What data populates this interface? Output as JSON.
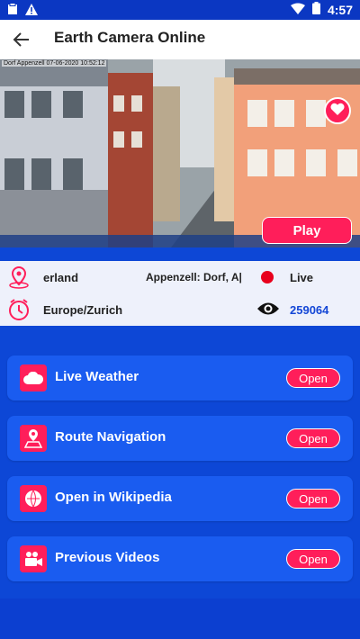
{
  "status": {
    "time": "4:57",
    "left_icons": [
      "clipboard-icon",
      "alert-icon"
    ],
    "right_icons": [
      "wifi-icon",
      "battery-icon"
    ]
  },
  "appbar": {
    "title": "Earth Camera Online"
  },
  "camera": {
    "timestamp": "Dorf Appenzell 07-06-2020 10:52:12",
    "play_label": "Play"
  },
  "info": {
    "location_country": "erland",
    "location_name": "Appenzell: Dorf, A|",
    "live_label": "Live",
    "timezone": "Europe/Zurich",
    "views": "259064"
  },
  "cards": [
    {
      "label": "Live Weather",
      "button": "Open",
      "icon": "cloud-icon"
    },
    {
      "label": "Route Navigation",
      "button": "Open",
      "icon": "map-pin-icon"
    },
    {
      "label": "Open in Wikipedia",
      "button": "Open",
      "icon": "wikipedia-icon"
    },
    {
      "label": "Previous Videos",
      "button": "Open",
      "icon": "video-camera-icon"
    }
  ],
  "colors": {
    "primary": "#0d47d6",
    "accent": "#ff1e5a",
    "card": "#1a5cf0"
  }
}
